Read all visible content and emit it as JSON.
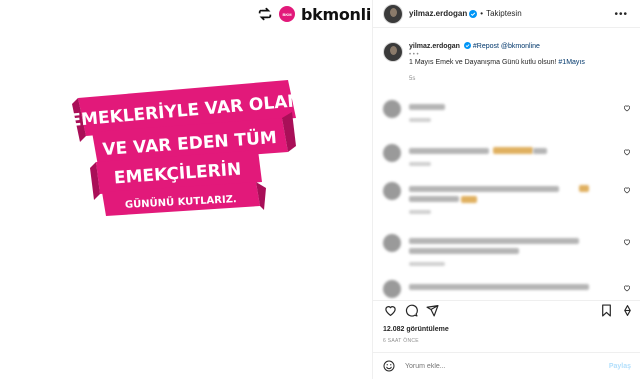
{
  "media": {
    "brand_name": "bkmonline",
    "brand_badge_text": "BKM",
    "banner_lines": [
      "EMEKLERİYLE VAR OLAN",
      "VE VAR EDEN TÜM",
      "EMEKÇİLERİN",
      "GÜNÜNÜ KUTLARIZ."
    ],
    "banner_color": "#e2197a",
    "banner_dark_color": "#a90f58"
  },
  "header": {
    "username": "yilmaz.erdogan",
    "separator": "•",
    "follow_label": "Takiptesin",
    "more_label": "•••"
  },
  "caption": {
    "username": "yilmaz.erdogan",
    "repost_label": "#Repost @bkmonline",
    "dots": "• • •",
    "text": "1 Mayıs Emek ve Dayanışma Günü kutlu olsun! ",
    "hashtag": "#1Mayıs",
    "time": "5s"
  },
  "comments_count_visible": 5,
  "stats": {
    "views": "12.082 görüntüleme",
    "posted": "6 SAAT ÖNCE"
  },
  "add_comment": {
    "placeholder": "Yorum ekle...",
    "post_label": "Paylaş"
  },
  "colors": {
    "verified": "#0095f6",
    "hashtag": "#00376b",
    "muted": "#8e8e8e"
  }
}
